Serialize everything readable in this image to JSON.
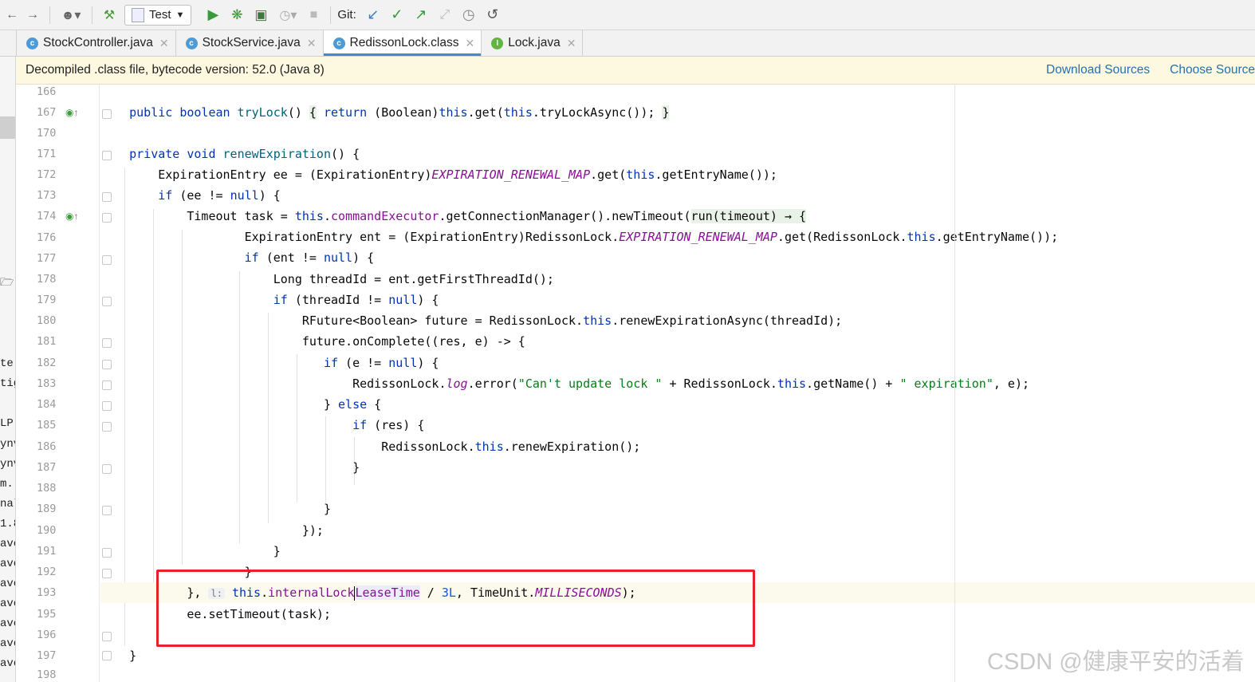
{
  "toolbar": {
    "run_config_label": "Test",
    "git_label": "Git:"
  },
  "tabs": [
    {
      "label": "StockController.java",
      "kind": "class"
    },
    {
      "label": "StockService.java",
      "kind": "class"
    },
    {
      "label": "RedissonLock.class",
      "kind": "class",
      "active": true
    },
    {
      "label": "Lock.java",
      "kind": "interface"
    }
  ],
  "banner": {
    "message": "Decompiled .class file, bytecode version: 52.0 (Java 8)",
    "download_sources": "Download Sources",
    "choose_sources": "Choose Source"
  },
  "left_strip_fragments": [
    "te",
    "tig",
    "LP",
    "ynv",
    "ynv",
    "m.",
    "nal",
    "1.8",
    "ave",
    "ave",
    "ave",
    "ave",
    "ave",
    "ave",
    "ave"
  ],
  "editor": {
    "line_numbers": [
      "166",
      "167",
      "170",
      "171",
      "172",
      "173",
      "174",
      "176",
      "177",
      "178",
      "179",
      "180",
      "181",
      "182",
      "183",
      "184",
      "185",
      "186",
      "187",
      "188",
      "189",
      "190",
      "191",
      "192",
      "193",
      "195",
      "196",
      "197",
      "198"
    ],
    "lines": {
      "l167": {
        "kw1": "public",
        "kw2": "boolean",
        "name": "tryLock",
        "p1": "()",
        "b1": "{",
        "kw3": "return",
        "t1": " (Boolean)",
        "kw4": "this",
        "t2": ".get(",
        "kw5": "this",
        "t3": ".tryLockAsync());",
        "b2": "}"
      },
      "l171": {
        "kw1": "private",
        "kw2": "void",
        "name": "renewExpiration",
        "t1": "() {"
      },
      "l172": {
        "t1": "ExpirationEntry ee = (ExpirationEntry)",
        "sf": "EXPIRATION_RENEWAL_MAP",
        "t2": ".get(",
        "kw": "this",
        "t3": ".getEntryName());"
      },
      "l173": {
        "kw1": "if",
        "t1": " (ee != ",
        "kw2": "null",
        "t2": ") {"
      },
      "l174": {
        "t1": "Timeout task = ",
        "kw": "this",
        "t2": ".",
        "fld": "commandExecutor",
        "t3": ".getConnectionManager().newTimeout(",
        "lam": "run(timeout) → {"
      },
      "l176": {
        "t1": "ExpirationEntry ent = (ExpirationEntry)RedissonLock.",
        "sf": "EXPIRATION_RENEWAL_MAP",
        "t2": ".get(RedissonLock.",
        "kw": "this",
        "t3": ".getEntryName());"
      },
      "l177": {
        "kw1": "if",
        "t1": " (ent != ",
        "kw2": "null",
        "t2": ") {"
      },
      "l178": {
        "t1": "Long threadId = ent.getFirstThreadId();"
      },
      "l179": {
        "kw1": "if",
        "t1": " (threadId != ",
        "kw2": "null",
        "t2": ") {"
      },
      "l180": {
        "t1": "RFuture<Boolean> future = RedissonLock.",
        "kw": "this",
        "t2": ".renewExpirationAsync(threadId);"
      },
      "l181": {
        "t1": "future.onComplete((res, e) -> {"
      },
      "l182": {
        "kw1": "if",
        "t1": " (e != ",
        "kw2": "null",
        "t2": ") {"
      },
      "l183": {
        "t1": "RedissonLock.",
        "sf": "log",
        "t2": ".error(",
        "s1": "\"Can't update lock \"",
        "t3": " + RedissonLock.",
        "kw": "this",
        "t4": ".getName() + ",
        "s2": "\" expiration\"",
        "t5": ", e);"
      },
      "l184": {
        "t1": "} ",
        "kw": "else",
        "t2": " {"
      },
      "l185": {
        "kw": "if",
        "t1": " (res) {"
      },
      "l186": {
        "t1": "RedissonLock.",
        "kw": "this",
        "t2": ".renewExpiration();"
      },
      "l187": {
        "t1": "}"
      },
      "l189": {
        "t1": "}"
      },
      "l190": {
        "t1": "});"
      },
      "l191": {
        "t1": "}"
      },
      "l192": {
        "t1": "}"
      },
      "l193": {
        "t1": "}, ",
        "hint": "l:",
        "kw": "this",
        "t2": ".",
        "fld1": "internalLock",
        "fld2": "LeaseTime",
        "t3": " / ",
        "num": "3L",
        "t4": ", TimeUnit.",
        "sf": "MILLISECONDS",
        "t5": ");"
      },
      "l195": {
        "t1": "ee.setTimeout(task);"
      },
      "l197": {
        "t1": "}"
      }
    }
  },
  "watermark": "CSDN @健康平安的活着"
}
